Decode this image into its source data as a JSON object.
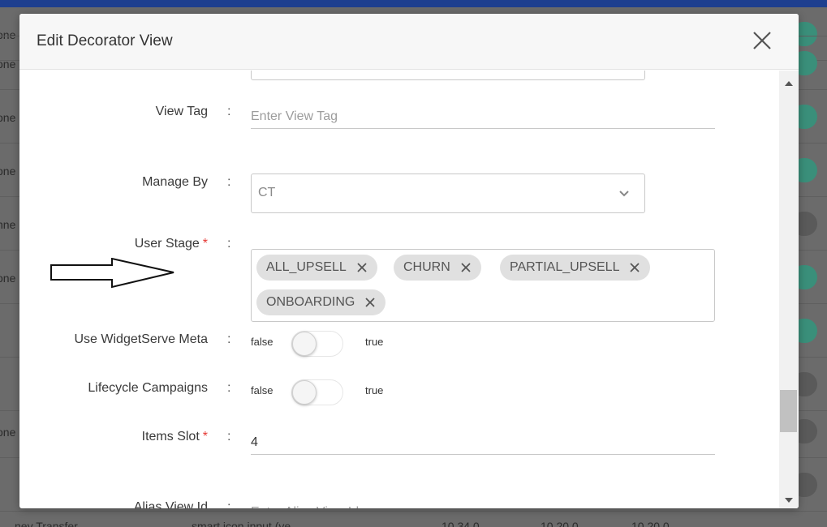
{
  "background": {
    "row_fragments": [
      "one",
      "one",
      "one",
      "nne",
      "one",
      "",
      "",
      "one",
      ""
    ],
    "bottom_texts": [
      "ney Transfer",
      "smart icon input (ve",
      "10.34.0",
      "10.20.0",
      "10.20.0"
    ]
  },
  "modal": {
    "title": "Edit Decorator View",
    "close_icon": "close-icon"
  },
  "form": {
    "view_tag": {
      "label": "View Tag",
      "colon": ":",
      "placeholder": "Enter View Tag",
      "value": ""
    },
    "manage_by": {
      "label": "Manage By",
      "colon": ":",
      "value": "CT",
      "icon": "chevron-down-icon"
    },
    "user_stage": {
      "label": "User Stage",
      "required_mark": "*",
      "colon": ":",
      "chips": [
        "ALL_UPSELL",
        "CHURN",
        "PARTIAL_UPSELL",
        "ONBOARDING"
      ]
    },
    "use_widgetserve_meta": {
      "label": "Use WidgetServe Meta",
      "colon": ":",
      "false_label": "false",
      "true_label": "true",
      "value": false
    },
    "lifecycle_campaigns": {
      "label": "Lifecycle Campaigns",
      "colon": ":",
      "false_label": "false",
      "true_label": "true",
      "value": false
    },
    "items_slot": {
      "label": "Items Slot",
      "required_mark": "*",
      "colon": ":",
      "value": "4"
    },
    "alias_view_id": {
      "label": "Alias View Id",
      "colon": ":",
      "placeholder": "Enter Alias View Id"
    }
  },
  "colors": {
    "header_bar": "#1e3f8f",
    "required": "#e53935",
    "chip_bg": "#e0e0e0",
    "toggle_on_bg": "#3a8f7a"
  }
}
